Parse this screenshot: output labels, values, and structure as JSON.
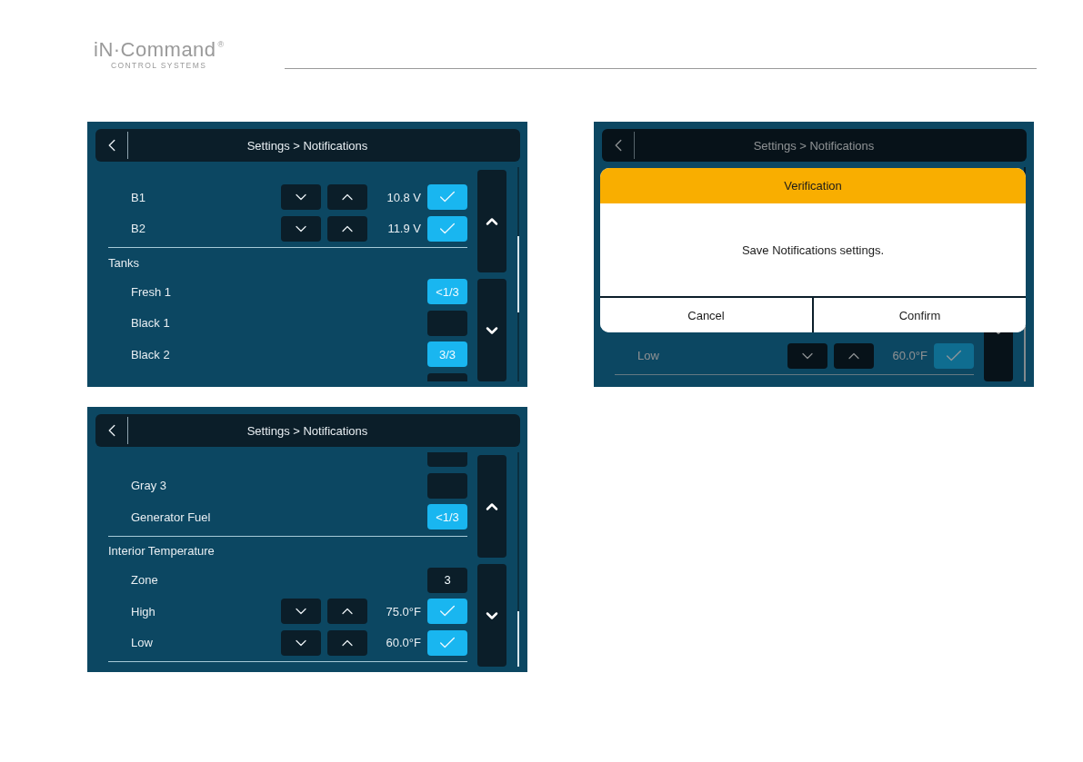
{
  "header": {
    "logo": "iN·Command",
    "registered": "®",
    "tagline": "CONTROL SYSTEMS"
  },
  "screens": [
    {
      "title": "Settings > Notifications",
      "dimmed": false,
      "rows": [
        {
          "kind": "adjust",
          "label": "B1",
          "value": "10.8 V",
          "checked": true
        },
        {
          "kind": "adjust",
          "label": "B2",
          "value": "11.9 V",
          "checked": true
        },
        {
          "kind": "divider"
        },
        {
          "kind": "section",
          "label": "Tanks"
        },
        {
          "kind": "badge",
          "label": "Fresh 1",
          "text": "<1/3",
          "on": true
        },
        {
          "kind": "badge",
          "label": "Black 1",
          "on": false
        },
        {
          "kind": "badge",
          "label": "Black 2",
          "text": "3/3",
          "on": true
        },
        {
          "kind": "stub"
        }
      ]
    },
    {
      "title": "Settings > Notifications",
      "dimmed": false,
      "rows": [
        {
          "kind": "stub"
        },
        {
          "kind": "badge",
          "label": "Gray 3",
          "on": false
        },
        {
          "kind": "badge",
          "label": "Generator Fuel",
          "text": "<1/3",
          "on": true
        },
        {
          "kind": "divider"
        },
        {
          "kind": "section",
          "label": "Interior Temperature"
        },
        {
          "kind": "badge",
          "label": "Zone",
          "text": "3",
          "on": false
        },
        {
          "kind": "adjust",
          "label": "High",
          "value": "75.0°F",
          "checked": true
        },
        {
          "kind": "adjust",
          "label": "Low",
          "value": "60.0°F",
          "checked": true
        },
        {
          "kind": "divider"
        }
      ]
    },
    {
      "title": "Settings > Notifications",
      "dimmed": true,
      "rows": [
        {
          "kind": "adjust",
          "label": "Low",
          "value": "60.0°F",
          "checked": true
        },
        {
          "kind": "divider"
        }
      ],
      "dialog": {
        "title": "Verification",
        "message": "Save Notifications settings.",
        "buttons": [
          "Cancel",
          "Confirm"
        ]
      }
    }
  ]
}
